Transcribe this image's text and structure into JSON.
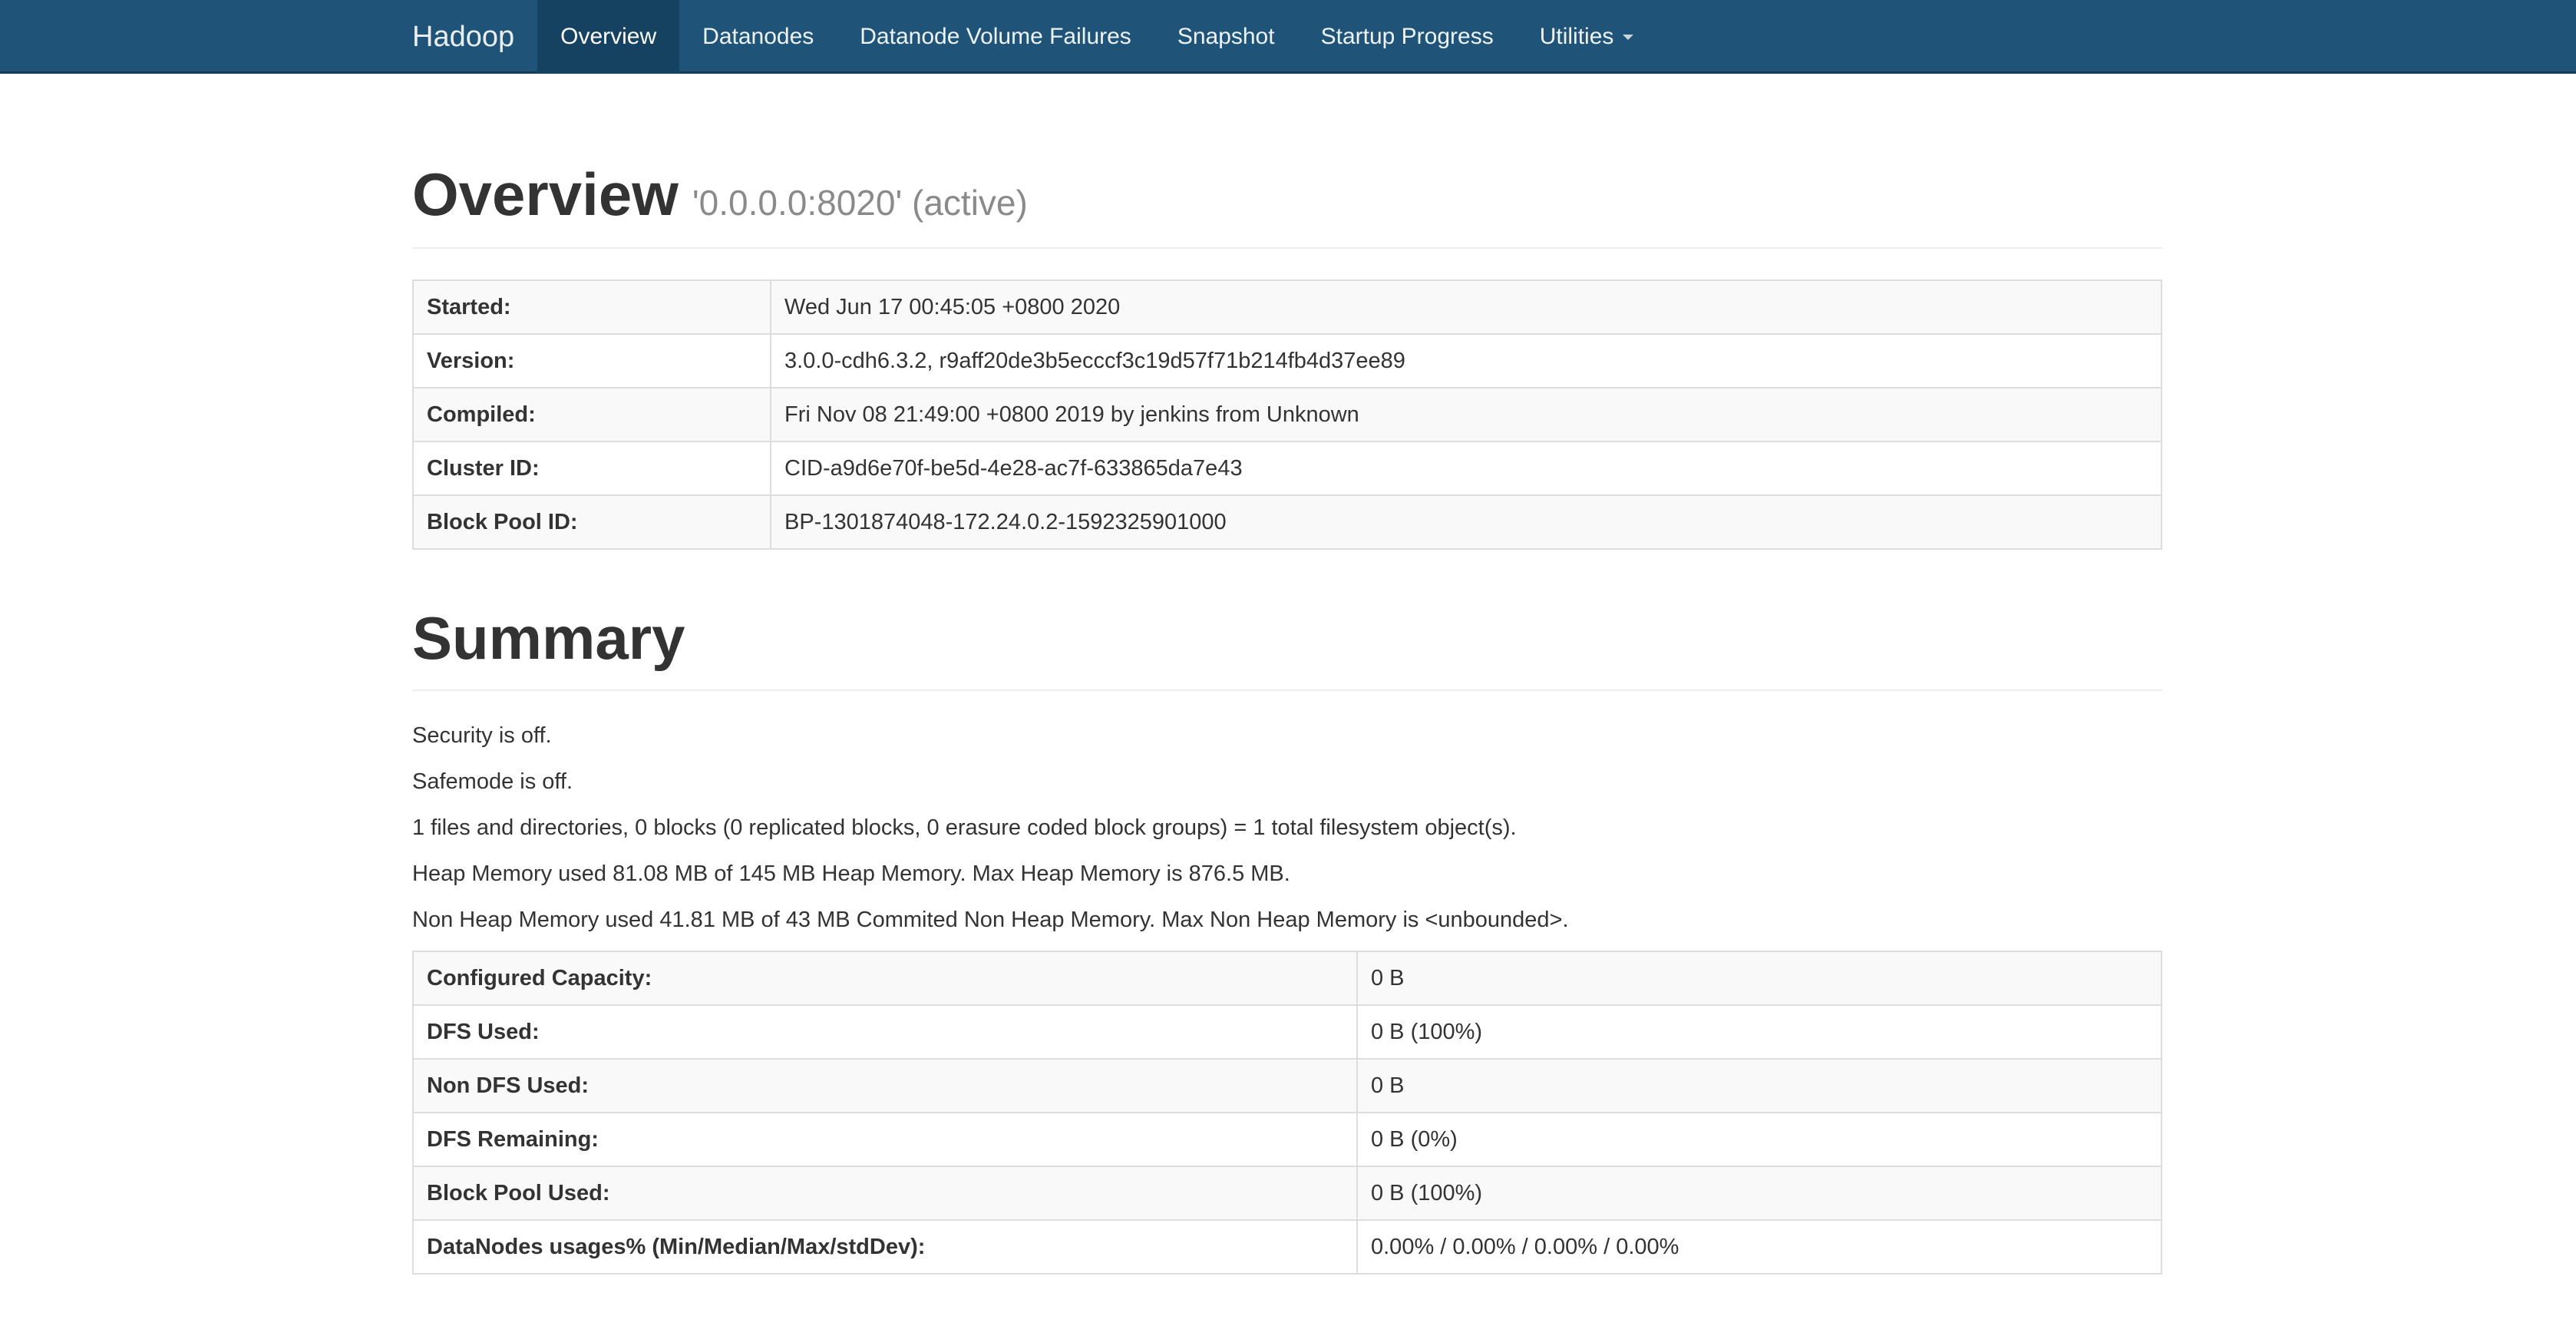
{
  "navbar": {
    "brand": "Hadoop",
    "items": [
      {
        "label": "Overview",
        "active": true
      },
      {
        "label": "Datanodes"
      },
      {
        "label": "Datanode Volume Failures"
      },
      {
        "label": "Snapshot"
      },
      {
        "label": "Startup Progress"
      },
      {
        "label": "Utilities"
      }
    ]
  },
  "overview": {
    "title": "Overview",
    "subtitle": "'0.0.0.0:8020' (active)",
    "rows": [
      {
        "label": "Started:",
        "value": "Wed Jun 17 00:45:05 +0800 2020"
      },
      {
        "label": "Version:",
        "value": "3.0.0-cdh6.3.2, r9aff20de3b5ecccf3c19d57f71b214fb4d37ee89"
      },
      {
        "label": "Compiled:",
        "value": "Fri Nov 08 21:49:00 +0800 2019 by jenkins from Unknown"
      },
      {
        "label": "Cluster ID:",
        "value": "CID-a9d6e70f-be5d-4e28-ac7f-633865da7e43"
      },
      {
        "label": "Block Pool ID:",
        "value": "BP-1301874048-172.24.0.2-1592325901000"
      }
    ]
  },
  "summary": {
    "title": "Summary",
    "lines": [
      "Security is off.",
      "Safemode is off.",
      "1 files and directories, 0 blocks (0 replicated blocks, 0 erasure coded block groups) = 1 total filesystem object(s).",
      "Heap Memory used 81.08 MB of 145 MB Heap Memory. Max Heap Memory is 876.5 MB.",
      "Non Heap Memory used 41.81 MB of 43 MB Commited Non Heap Memory. Max Non Heap Memory is <unbounded>."
    ],
    "rows": [
      {
        "label": "Configured Capacity:",
        "value": "0 B"
      },
      {
        "label": "DFS Used:",
        "value": "0 B (100%)"
      },
      {
        "label": "Non DFS Used:",
        "value": "0 B"
      },
      {
        "label": "DFS Remaining:",
        "value": "0 B (0%)"
      },
      {
        "label": "Block Pool Used:",
        "value": "0 B (100%)"
      },
      {
        "label": "DataNodes usages% (Min/Median/Max/stdDev):",
        "value": "0.00% / 0.00% / 0.00% / 0.00%"
      }
    ]
  },
  "colors": {
    "navbar_bg": "#1f5478",
    "navbar_active_bg": "#164262",
    "table_stripe": "#f9f9f9",
    "table_border": "#dddddd"
  }
}
